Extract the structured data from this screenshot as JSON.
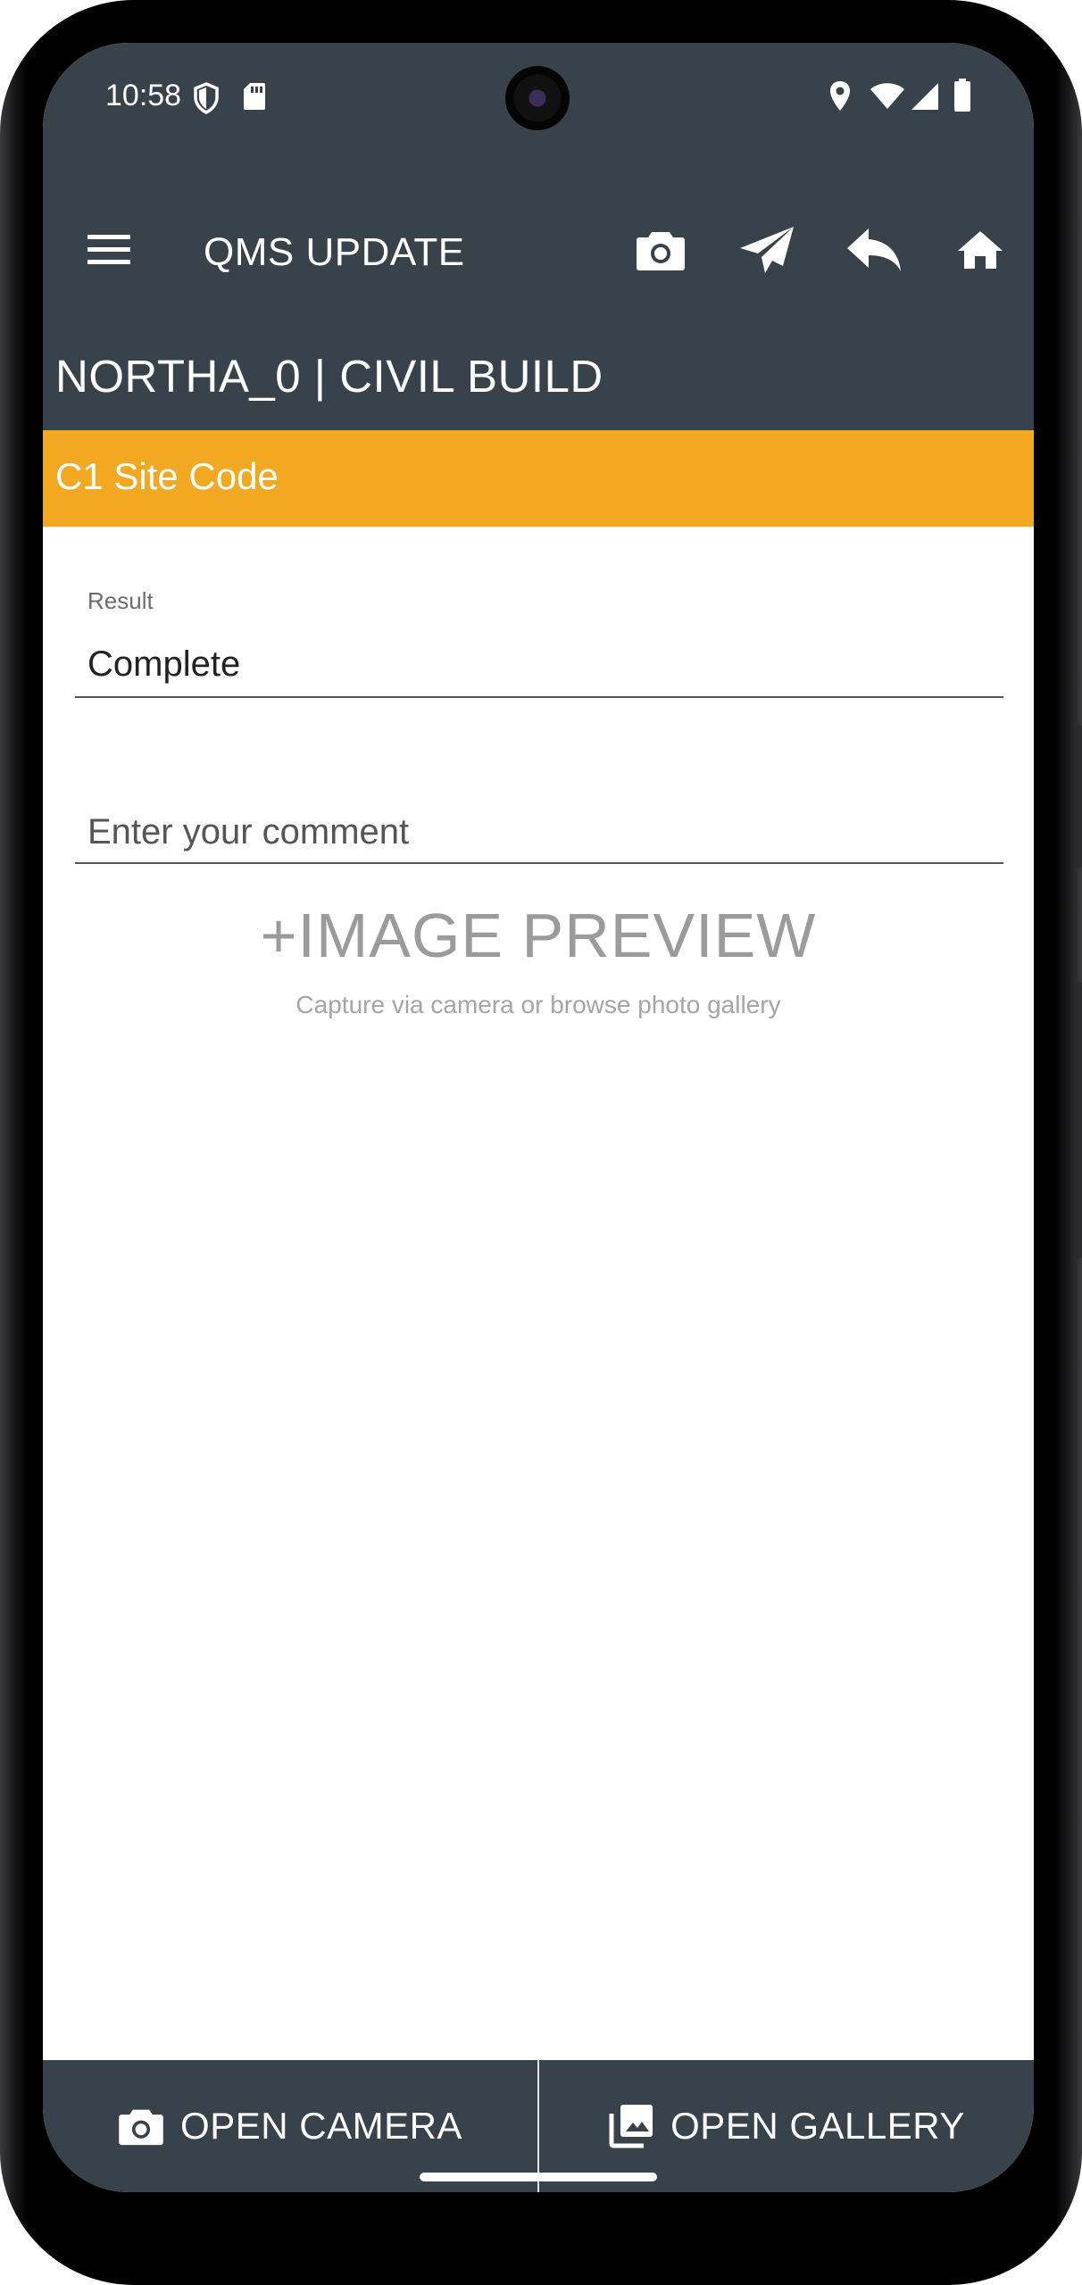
{
  "status_bar": {
    "time": "10:58",
    "icons": [
      "shield-icon",
      "sd-card-icon",
      "location-icon",
      "wifi-icon",
      "signal-icon",
      "battery-icon"
    ]
  },
  "app_bar": {
    "menu_icon": "menu-icon",
    "title": "QMS UPDATE",
    "actions": [
      "camera-icon",
      "send-icon",
      "reply-icon",
      "home-icon"
    ]
  },
  "site": {
    "title": "NORTHA_0 | CIVIL BUILD"
  },
  "section": {
    "title": "C1 Site Code"
  },
  "form": {
    "result_label": "Result",
    "result_value": "Complete",
    "comment_placeholder": "Enter your comment"
  },
  "preview": {
    "title": "+IMAGE PREVIEW",
    "subtitle": "Capture via camera or browse photo gallery"
  },
  "bottom": {
    "open_camera": "OPEN CAMERA",
    "open_gallery": "OPEN GALLERY"
  },
  "colors": {
    "primary": "#37424b",
    "accent": "#f2a921",
    "muted_text": "#9b9b9b"
  }
}
